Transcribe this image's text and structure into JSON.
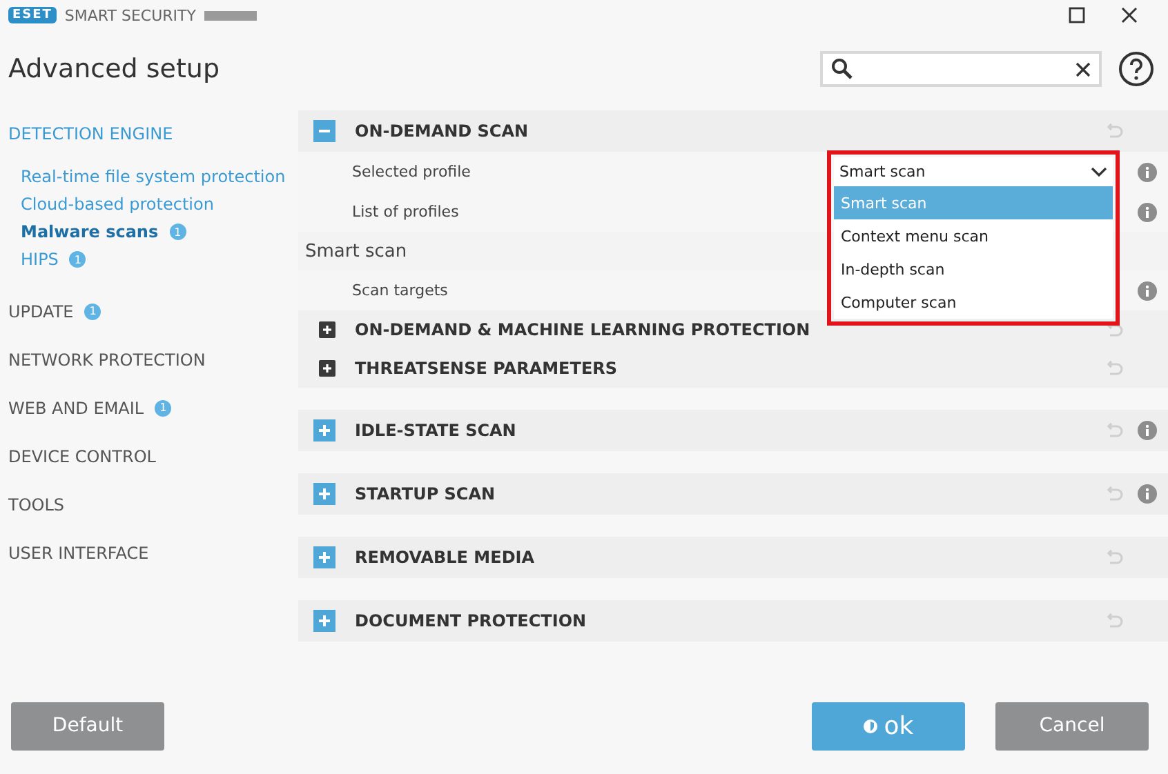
{
  "window": {
    "logo": "ESET",
    "product": "SMART SECURITY",
    "title": "Advanced setup"
  },
  "sidebar": {
    "items": [
      {
        "label": "DETECTION ENGINE",
        "kind": "group",
        "selected": false
      },
      {
        "label": "Real-time file system protection",
        "kind": "sub",
        "selected": false
      },
      {
        "label": "Cloud-based protection",
        "kind": "sub",
        "selected": false
      },
      {
        "label": "Malware scans",
        "kind": "sub",
        "selected": true,
        "badge": "1"
      },
      {
        "label": "HIPS",
        "kind": "sub",
        "selected": false,
        "badge": "1"
      },
      {
        "label": "UPDATE",
        "kind": "top",
        "selected": false,
        "badge": "1"
      },
      {
        "label": "NETWORK PROTECTION",
        "kind": "top",
        "selected": false
      },
      {
        "label": "WEB AND EMAIL",
        "kind": "top",
        "selected": false,
        "badge": "1"
      },
      {
        "label": "DEVICE CONTROL",
        "kind": "top",
        "selected": false
      },
      {
        "label": "TOOLS",
        "kind": "top",
        "selected": false
      },
      {
        "label": "USER INTERFACE",
        "kind": "top",
        "selected": false
      }
    ]
  },
  "sections": [
    {
      "title": "ON-DEMAND SCAN",
      "expanded": true,
      "info": false,
      "rows": [
        {
          "kind": "setting",
          "label": "Selected profile",
          "info": true,
          "dropdown": {
            "value": "Smart scan",
            "open": true,
            "highlighted": true,
            "options": [
              {
                "label": "Smart scan",
                "selected": true
              },
              {
                "label": "Context menu scan",
                "selected": false
              },
              {
                "label": "In-depth scan",
                "selected": false
              },
              {
                "label": "Computer scan",
                "selected": false
              }
            ]
          }
        },
        {
          "kind": "setting",
          "label": "List of profiles",
          "info": true
        },
        {
          "kind": "heading",
          "label": "Smart scan"
        },
        {
          "kind": "setting",
          "label": "Scan targets",
          "info": true
        },
        {
          "kind": "subsection",
          "label": "ON-DEMAND & MACHINE LEARNING PROTECTION"
        },
        {
          "kind": "subsection",
          "label": "THREATSENSE PARAMETERS"
        }
      ]
    },
    {
      "title": "IDLE-STATE SCAN",
      "expanded": false,
      "info": true
    },
    {
      "title": "STARTUP SCAN",
      "expanded": false,
      "info": true
    },
    {
      "title": "REMOVABLE MEDIA",
      "expanded": false,
      "info": false
    },
    {
      "title": "DOCUMENT PROTECTION",
      "expanded": false,
      "info": false
    }
  ],
  "buttons": [
    {
      "label": "Default",
      "kind": "default"
    },
    {
      "label": "ok",
      "kind": "primary"
    },
    {
      "label": "Cancel",
      "kind": "cancel"
    }
  ]
}
